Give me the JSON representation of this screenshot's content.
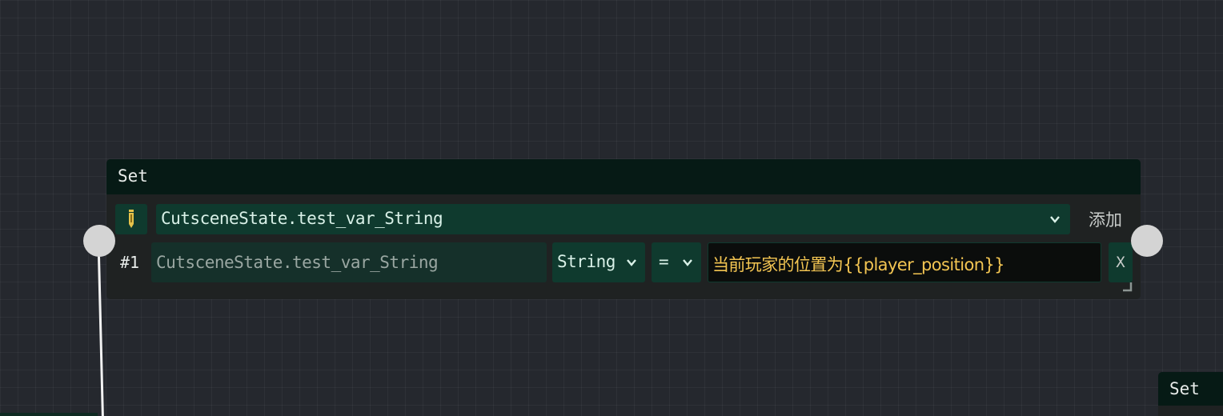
{
  "node": {
    "title": "Set",
    "variable_select": "CutsceneState.test_var_String",
    "add_label": "添加",
    "rows": [
      {
        "index_label": "#1",
        "variable_name": "CutsceneState.test_var_String",
        "type": "String",
        "operator": "=",
        "value": "当前玩家的位置为{{player_position}}",
        "remove_label": "X"
      }
    ]
  },
  "peek_node": {
    "title": "Set"
  },
  "colors": {
    "canvas_bg": "#25282e",
    "header_bg": "#061a15",
    "field_bg": "#0f3a2e",
    "value_text": "#f3c552",
    "port": "#d4d4d4"
  },
  "icons": {
    "edit": "pencil-icon",
    "dropdown": "chevron-down-icon",
    "resize": "resize-handle-icon"
  }
}
